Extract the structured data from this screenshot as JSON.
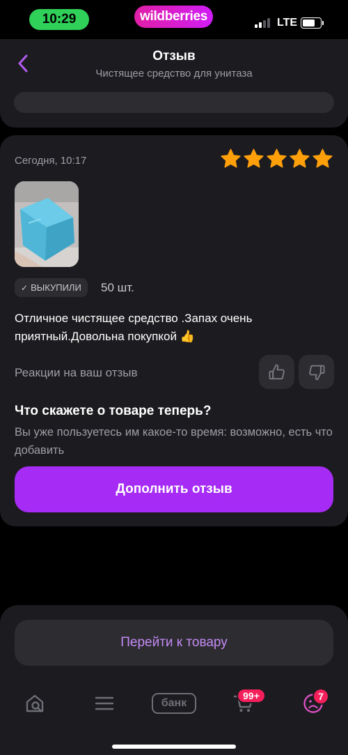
{
  "status_bar": {
    "time": "10:29",
    "brand": "wildberries",
    "network": "LTE"
  },
  "header": {
    "title": "Отзыв",
    "subtitle": "Чистящее средство для унитаза"
  },
  "review": {
    "date": "Сегодня, 10:17",
    "rating": 5,
    "rating_max": 5,
    "bought_label": "ВЫКУПИЛИ",
    "quantity": "50 шт.",
    "text": "Отличное чистящее средство .Запах очень приятный.Довольна покупкой 👍",
    "reactions_label": "Реакции на ваш отзыв",
    "followup_title": "Что скажете о товаре теперь?",
    "followup_text": "Вы уже пользуетесь им какое-то время: возможно, есть что добавить",
    "add_button": "Дополнить отзыв"
  },
  "bottom": {
    "goto_button": "Перейти к товару"
  },
  "tabbar": {
    "bank_label": "банк",
    "cart_badge": "99+",
    "profile_badge": "7"
  },
  "colors": {
    "accent": "#a62bf4",
    "star": "#ff9f0a",
    "badge": "#f51f5b",
    "card": "#1c1c20"
  }
}
